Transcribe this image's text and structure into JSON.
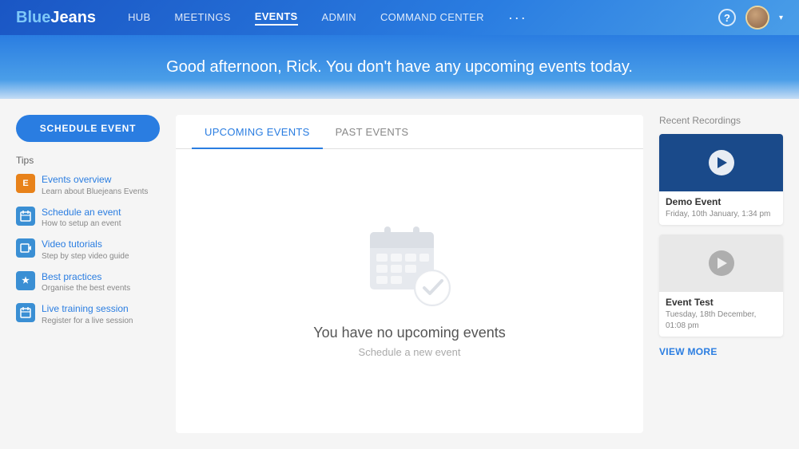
{
  "brand": {
    "name_blue": "Blue",
    "name_rest": "Jeans"
  },
  "nav": {
    "links": [
      {
        "id": "hub",
        "label": "HUB",
        "active": false
      },
      {
        "id": "meetings",
        "label": "MEETINGS",
        "active": false
      },
      {
        "id": "events",
        "label": "EVENTS",
        "active": true
      },
      {
        "id": "admin",
        "label": "ADMIN",
        "active": false
      },
      {
        "id": "command-center",
        "label": "COMMAND CENTER",
        "active": false
      }
    ],
    "help_label": "?",
    "chevron": "▾"
  },
  "hero": {
    "message": "Good afternoon, Rick. You don't have any upcoming events today."
  },
  "sidebar": {
    "schedule_btn": "SCHEDULE EVENT",
    "tips_label": "Tips",
    "tips": [
      {
        "id": "events-overview",
        "icon": "E",
        "icon_style": "orange",
        "title": "Events overview",
        "sub": "Learn about Bluejeans Events"
      },
      {
        "id": "schedule-event",
        "icon": "S",
        "icon_style": "blue2",
        "title": "Schedule an event",
        "sub": "How to setup an event"
      },
      {
        "id": "video-tutorials",
        "icon": "V",
        "icon_style": "blue2",
        "title": "Video tutorials",
        "sub": "Step by step video guide"
      },
      {
        "id": "best-practices",
        "icon": "★",
        "icon_style": "blue2",
        "title": "Best practices",
        "sub": "Organise the best events"
      },
      {
        "id": "live-training",
        "icon": "L",
        "icon_style": "blue2",
        "title": "Live training session",
        "sub": "Register for a live session"
      }
    ]
  },
  "tabs": [
    {
      "id": "upcoming",
      "label": "UPCOMING EVENTS",
      "active": true
    },
    {
      "id": "past",
      "label": "PAST EVENTS",
      "active": false
    }
  ],
  "empty_state": {
    "title": "You have no upcoming events",
    "subtitle": "Schedule a new event"
  },
  "right_panel": {
    "title": "Recent Recordings",
    "recordings": [
      {
        "id": "demo-event",
        "name": "Demo Event",
        "date": "Friday, 10th January, 1:34 pm",
        "thumb_dark": true
      },
      {
        "id": "event-test",
        "name": "Event Test",
        "date": "Tuesday, 18th December, 01:08 pm",
        "thumb_dark": false
      }
    ],
    "view_more": "VIEW MORE"
  }
}
